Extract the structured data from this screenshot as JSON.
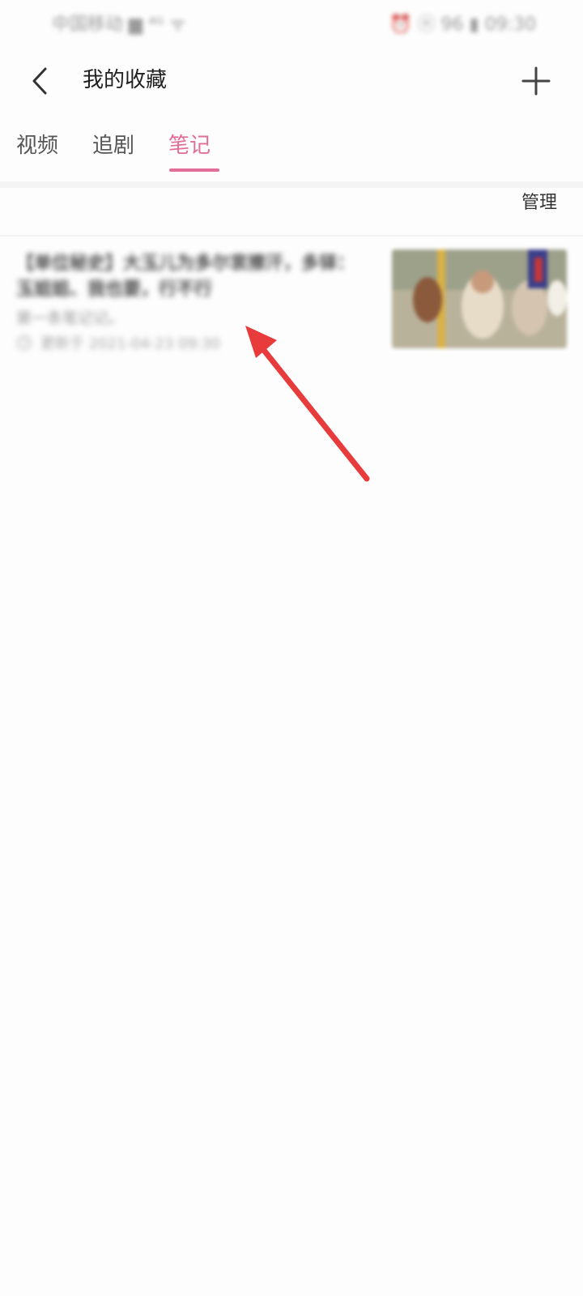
{
  "status_bar": {
    "left_text": "中国移动 ▆ ⁴ᴳ ᯤ",
    "right_text": "⏰ ⓝ 96 ▮ 09:30"
  },
  "header": {
    "title": "我的收藏",
    "back_icon": "chevron-left-icon",
    "add_icon": "plus-icon"
  },
  "tabs": [
    {
      "label": "视频",
      "active": false
    },
    {
      "label": "追剧",
      "active": false
    },
    {
      "label": "笔记",
      "active": true
    }
  ],
  "accent_color": "#e26d97",
  "manage_label": "管理",
  "notes": [
    {
      "title": "【单位秘史】大玉儿为多尔衮擦汗，多铎：玉姐姐、我也要，行不行",
      "summary": "第一条笔记记。",
      "meta": "更新于 2021-04-23 09:30",
      "meta_icon": "clock-icon"
    }
  ],
  "annotation": {
    "type": "red-arrow",
    "color": "#e83b3b"
  }
}
